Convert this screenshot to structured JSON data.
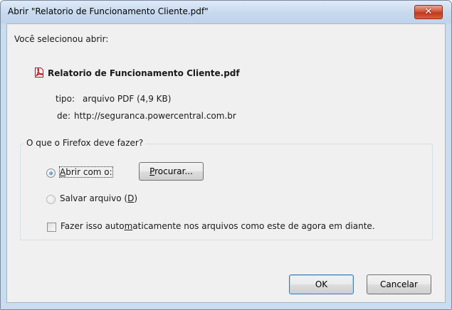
{
  "window": {
    "title": "Abrir \"Relatorio de Funcionamento Cliente.pdf\"",
    "close_label": "✕"
  },
  "dialog": {
    "intro": "Você selecionou abrir:",
    "file_icon": "pdf-file-icon",
    "file_name": "Relatorio de Funcionamento Cliente.pdf",
    "type_label": "tipo:",
    "type_value": "arquivo PDF (4,9 KB)",
    "from_label": "de:",
    "from_value": "http://seguranca.powercentral.com.br"
  },
  "action_group": {
    "legend": "O que o Firefox deve fazer?",
    "open_with": {
      "accel": "A",
      "rest": "brir com o:",
      "checked": true
    },
    "browse_button": {
      "accel": "P",
      "rest": "rocurar..."
    },
    "save_file": {
      "label_before": "Salvar arquivo (",
      "accel": "D",
      "label_after": ")",
      "checked": false,
      "disabled": true
    },
    "auto": {
      "before": "Fazer isso auto",
      "accel": "m",
      "after": "aticamente nos arquivos como este de agora em diante.",
      "checked": false
    }
  },
  "footer": {
    "ok_label": "OK",
    "cancel_label": "Cancelar"
  },
  "colors": {
    "accent": "#3c7fb1",
    "close": "#c1381d",
    "pdf_red": "#c4161c"
  }
}
